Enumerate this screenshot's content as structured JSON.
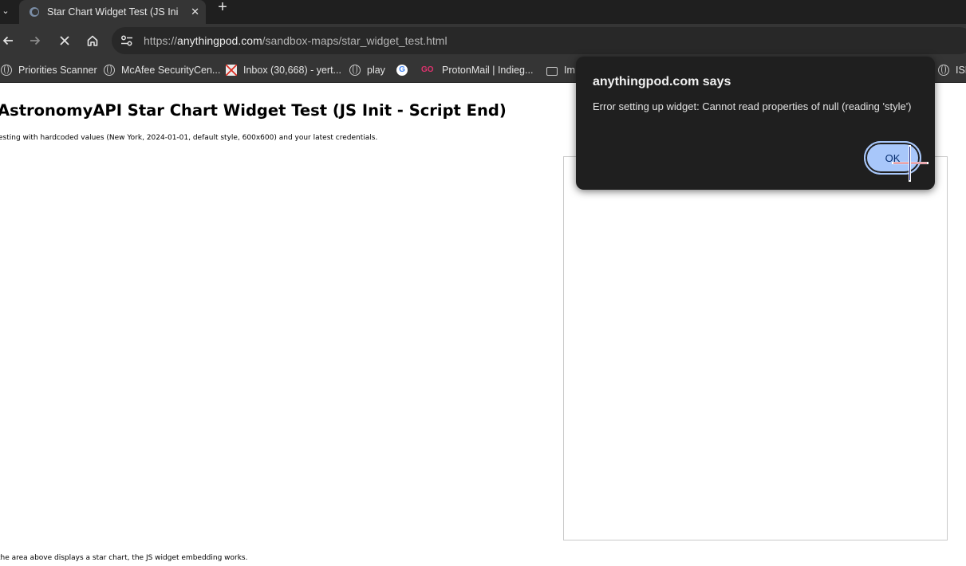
{
  "browser": {
    "tab": {
      "title": "Star Chart Widget Test (JS Init -",
      "close": "✕"
    },
    "new_tab": "+",
    "url": {
      "prefix": "https://",
      "host": "anythingpod.com",
      "path": "/sandbox-maps/star_widget_test.html"
    },
    "bookmarks": [
      {
        "label": "Priorities Scanner",
        "icon": "globe-icon"
      },
      {
        "label": "McAfee SecurityCen...",
        "icon": "globe-icon"
      },
      {
        "label": "Inbox (30,668) - yert...",
        "icon": "gmail-icon"
      },
      {
        "label": "play",
        "icon": "globe-icon"
      },
      {
        "label": "",
        "icon": "google-icon"
      },
      {
        "label": "ProtonMail | Indieg...",
        "icon": "proton-icon",
        "icon_text": "GO"
      },
      {
        "label": "Im",
        "icon": "folder-icon"
      },
      {
        "label": "ISN",
        "icon": "globe-icon"
      }
    ]
  },
  "page": {
    "title": "AstronomyAPI Star Chart Widget Test (JS Init - Script End)",
    "description": "esting with hardcoded values (New York, 2024-01-01, default style, 600x600) and your latest credentials.",
    "footer": " the area above displays a star chart, the JS widget embedding works."
  },
  "dialog": {
    "title": "anythingpod.com says",
    "message": "Error setting up widget: Cannot read properties of null (reading 'style')",
    "ok_label": "OK"
  },
  "colors": {
    "chrome_dark": "#1f1f1f",
    "chrome_toolbar": "#353535",
    "ok_button": "#a8c7fa"
  }
}
